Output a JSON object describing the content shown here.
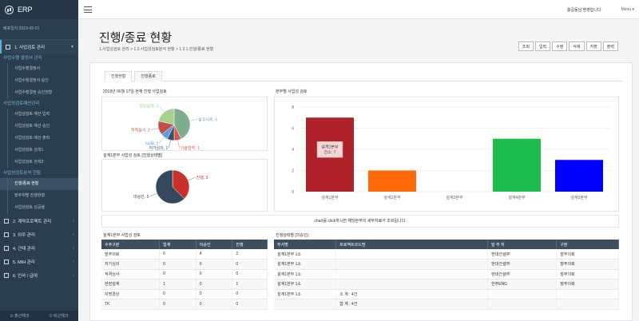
{
  "app": {
    "title": "ERP",
    "sys_date": "배포일자:2019-05-01"
  },
  "sidebar": {
    "groups": [
      {
        "label": "1. 사업검토 관리",
        "active": true
      },
      {
        "label": "2. 계약프로젝트 관리"
      },
      {
        "label": "3. 외주 관리"
      },
      {
        "label": "4. 근태 관리"
      },
      {
        "label": "5. MIH 관리"
      },
      {
        "label": "6. 인사 / 급여"
      }
    ],
    "sub_titles": [
      "사업수행 결정서 관리",
      "사업성검토예산관리",
      "사업성검토분석 현황"
    ],
    "items_a": [
      "사업수행결정서",
      "사업수행결정서 승인",
      "사업수행결정 승인현황"
    ],
    "items_b": [
      "사업성검토 예산 입력",
      "사업성검토 예산 승인",
      "사업성검토 예산 출력",
      "사업성검토 검색1",
      "사업성검토 검색2"
    ],
    "items_c": [
      "진행/종료 현황",
      "발주처별 진행현황",
      "사업성검토 성공율"
    ],
    "footer": {
      "in": "출근체크",
      "out": "퇴근체크"
    }
  },
  "topbar": {
    "welcome": "홍길동님 환영합니다.",
    "menu": "Menu"
  },
  "page": {
    "title": "진행/종료 현황",
    "breadcrumb": "1.사업성검토 관리 > 1.3.사업성검토분석 현황 > 1.3.1.진행/종료 현황",
    "toolbar": [
      "조회",
      "입력",
      "수정",
      "삭제",
      "저장",
      "출력"
    ]
  },
  "tabs": [
    "진행현황",
    "진행종료"
  ],
  "panels": {
    "pie1_title": "2019년 06월 17일 현재 진행 사업검토",
    "pie2_title": "설계1본부 사업성 검토 [진행상태별]",
    "bar_title": "본부별 사업성 검토",
    "notice": "chart를 click하시면 해당본부의 세부자료가 조회됩니다.",
    "table1_title": "설계1본부 사업성 검토",
    "table2_title": "진행상태별 [미승인]"
  },
  "chart_data": [
    {
      "type": "pie",
      "labels": [
        "발주의뢰",
        "기술협약",
        "저가심의",
        "NoM",
        "적격심사",
        "현장설계"
      ],
      "values": [
        6,
        1,
        1,
        1,
        2,
        3
      ],
      "slice_labels": [
        "발주의뢰, 6",
        "기술협약, 1",
        "저가심의, 1",
        "NoM, 1",
        "적격심사, 2",
        "현장설계, 3"
      ],
      "colors": [
        "#7fae8f",
        "#d9534f",
        "#3c4f63",
        "#5b9bd5",
        "#c0504d",
        "#a9d18e"
      ]
    },
    {
      "type": "pie",
      "labels": [
        "진행",
        "미승인"
      ],
      "values": [
        3,
        5
      ],
      "slice_labels": [
        "진행, 3",
        "미승인, 5"
      ],
      "colors": [
        "#c9302c",
        "#34495e"
      ]
    },
    {
      "type": "bar",
      "categories": [
        "설계1본부",
        "설계2본부",
        "설계3본부",
        "설계4본부",
        "설계5본부"
      ],
      "values": [
        7,
        2,
        0,
        5,
        3
      ],
      "colors": [
        "#b0222a",
        "#ff6a0a",
        "#999999",
        "#1dbb4b",
        "#0000ff"
      ],
      "ylim": [
        0,
        8
      ],
      "yticks": [
        "0",
        "2",
        "4",
        "6",
        "8"
      ],
      "tooltip": {
        "title": "설계1본부",
        "value": "건수: 7"
      }
    }
  ],
  "table1": {
    "headers": [
      "수주구분",
      "합계",
      "미승인",
      "진행"
    ],
    "rows": [
      [
        "발주의뢰",
        "6",
        "4",
        "2"
      ],
      [
        "저가심의",
        "0",
        "0",
        "0"
      ],
      [
        "적격심사",
        "0",
        "0",
        "0"
      ],
      [
        "현장설계",
        "1",
        "0",
        "1"
      ],
      [
        "지명경상",
        "0",
        "0",
        "0"
      ],
      [
        "TK",
        "0",
        "0",
        "0"
      ]
    ]
  },
  "table2": {
    "headers": [
      "부서명",
      "프로젝트코드명",
      "발 주 처",
      "구분"
    ],
    "rows": [
      [
        "설계1본부 1소",
        "",
        "현대건설㈜",
        "발주의뢰"
      ],
      [
        "설계1본부 1소",
        "",
        "현대건설㈜",
        "발주의뢰"
      ],
      [
        "설계1본부 1소",
        "",
        "현대건설㈜",
        "발주의뢰"
      ],
      [
        "설계1본부 1소",
        "",
        "한주ENG",
        "발주의뢰"
      ],
      [
        "설계1본부 1소",
        "소 계 : 4건",
        "",
        ""
      ],
      [
        "",
        "합 계 : 4건",
        "",
        ""
      ]
    ]
  }
}
